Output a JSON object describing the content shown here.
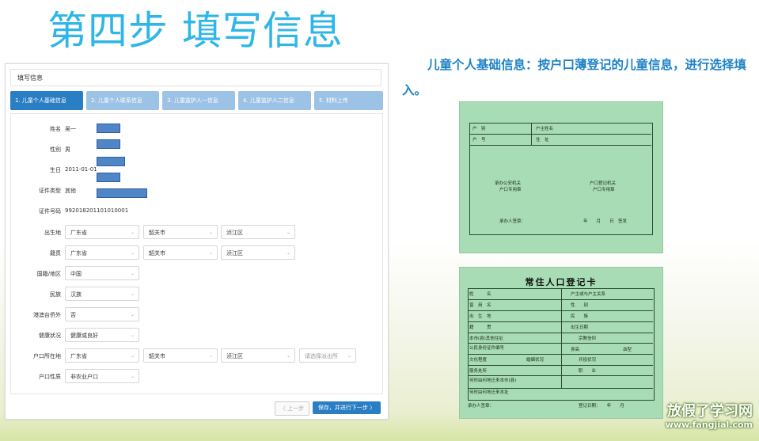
{
  "slide": {
    "title": "第四步 填写信息",
    "caption": "儿童个人基础信息：按户口薄登记的儿童信息，进行选择填入。"
  },
  "panel": {
    "header": "填写信息",
    "tabs": [
      "1. 儿童个人基础信息",
      "2. 儿童个人联系信息",
      "3. 儿童监护人一信息",
      "4. 儿童监护人二信息",
      "5. 材料上传"
    ],
    "active_tab": 0,
    "fields": {
      "name": {
        "label": "姓名",
        "value": "吴一"
      },
      "gender": {
        "label": "性别",
        "value": "男"
      },
      "birthday": {
        "label": "生日",
        "value": "2011-01-01"
      },
      "id_type": {
        "label": "证件类型",
        "value": "其他"
      },
      "id_number": {
        "label": "证件号码",
        "value": "992018201101010001"
      },
      "birthplace": {
        "label": "出生地",
        "province": "广东省",
        "city": "韶关市",
        "district": "浈江区"
      },
      "native_place": {
        "label": "籍贯",
        "province": "广东省",
        "city": "韶关市",
        "district": "浈江区"
      },
      "nationality": {
        "label": "国籍/地区",
        "value": "中国"
      },
      "ethnicity": {
        "label": "民族",
        "value": "汉族"
      },
      "hk_macao_taiwan": {
        "label": "港澳台侨外",
        "value": "否"
      },
      "health": {
        "label": "健康状况",
        "value": "健康或良好"
      },
      "hukou_location": {
        "label": "户口所在地",
        "province": "广东省",
        "city": "韶关市",
        "district": "浈江区",
        "police_placeholder": "请选择派出所"
      },
      "hukou_type": {
        "label": "户口性质",
        "value": "非农业户口"
      }
    },
    "buttons": {
      "prev": "〈 上一步",
      "next": "保存，并进行下一步 〉"
    }
  },
  "card1": {
    "row1": [
      "户　别",
      "户主姓名"
    ],
    "row2": [
      "户　号",
      "住　址"
    ],
    "seal_left": [
      "承办公安机关",
      "户口专用章"
    ],
    "seal_right": [
      "户口登记机关",
      "户口专用章"
    ],
    "signer": "承办人签章：",
    "date": "年　　月　　日　签发"
  },
  "card2": {
    "title": "常住人口登记卡",
    "left_labels": [
      "姓　　　名",
      "曾　用　名",
      "出　生　地",
      "籍　　　贯",
      "本市(县)其他住址",
      "公民身份证件编号",
      "文化程度",
      "服务处所",
      "何时由何地迁来本市(县)",
      "何时由何地迁来本址"
    ],
    "right_labels": [
      "户主或与户主关系",
      "性　　别",
      "民　　族",
      "出生日期",
      "宗教信仰",
      "身高",
      "血型",
      "婚姻状况",
      "兵役状况",
      "职　　业"
    ],
    "signer": "承办人签章：",
    "date": "登记日期：　　年　　月"
  },
  "watermark": {
    "line1": "放假了学习网",
    "line2": "www.fangjial.com"
  }
}
